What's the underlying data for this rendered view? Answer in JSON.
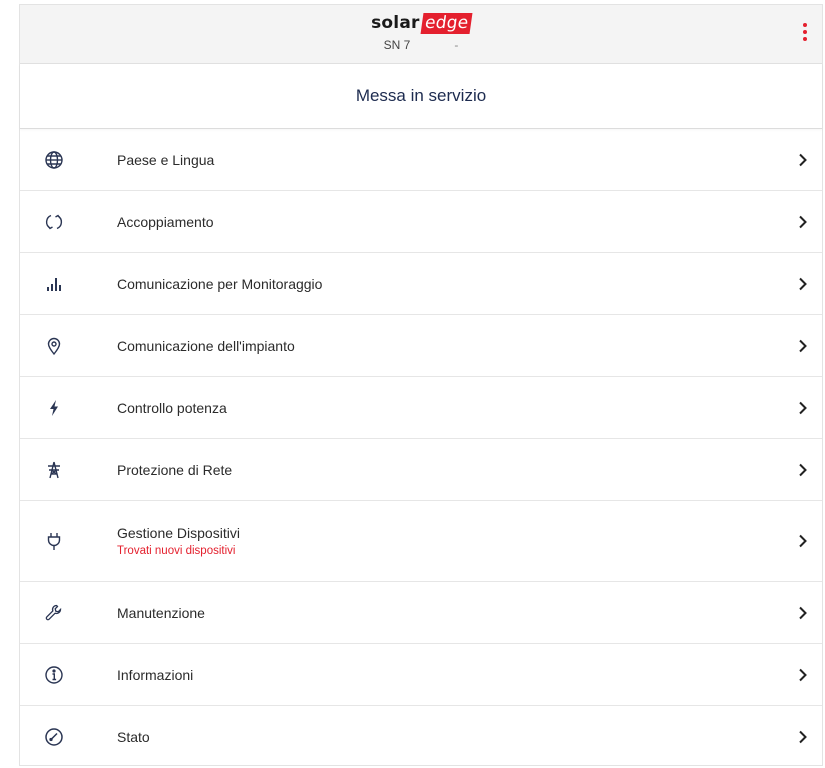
{
  "header": {
    "logo_solar": "solar",
    "logo_edge": "edge",
    "serial_label": "SN 7",
    "serial_sep": "-"
  },
  "page_title": "Messa in servizio",
  "menu": [
    {
      "label": "Paese e Lingua",
      "icon": "globe-icon"
    },
    {
      "label": "Accoppiamento",
      "icon": "sync-icon"
    },
    {
      "label": "Comunicazione per Monitoraggio",
      "icon": "signal-bars-icon"
    },
    {
      "label": "Comunicazione dell'impianto",
      "icon": "location-pin-icon"
    },
    {
      "label": "Controllo potenza",
      "icon": "lightning-icon"
    },
    {
      "label": "Protezione di Rete",
      "icon": "power-tower-icon"
    },
    {
      "label": "Gestione Dispositivi",
      "sublabel": "Trovati nuovi dispositivi",
      "icon": "plug-icon"
    },
    {
      "label": "Manutenzione",
      "icon": "wrench-icon"
    },
    {
      "label": "Informazioni",
      "icon": "info-icon"
    },
    {
      "label": "Stato",
      "icon": "gauge-icon"
    }
  ],
  "colors": {
    "brand_red": "#e4202e",
    "icon_navy": "#2a3553",
    "title_navy": "#1d2b4f"
  }
}
